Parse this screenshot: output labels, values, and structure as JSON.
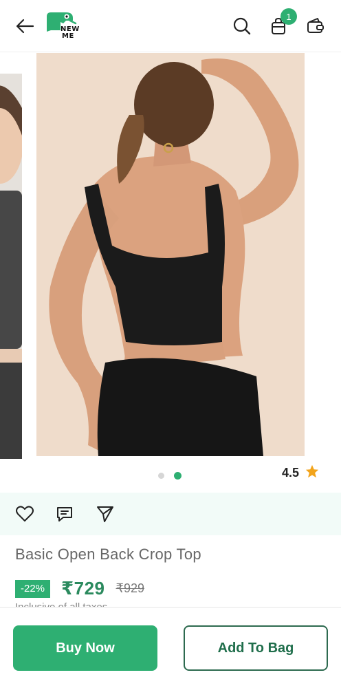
{
  "header": {
    "logo_text_line1": "NEW",
    "logo_text_line2": "ME",
    "cart_count": "1"
  },
  "carousel": {
    "dots": 2,
    "active_dot": 2
  },
  "rating": {
    "value": "4.5"
  },
  "product": {
    "title": "Basic Open Back Crop Top",
    "discount": "-22%",
    "price": "₹729",
    "mrp": "₹929",
    "taxes_note": "Inclusive of all taxes"
  },
  "footer": {
    "buy_now_label": "Buy Now",
    "add_to_bag_label": "Add To Bag"
  },
  "colors": {
    "brand_green": "#2eaf72",
    "price_green": "#2b8a5e",
    "star": "#f2a41b"
  }
}
